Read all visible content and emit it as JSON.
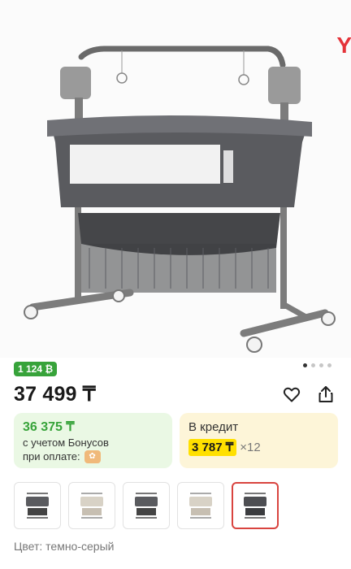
{
  "hero": {
    "brand_fragment": "Y",
    "image_alt": "crib product photo",
    "dots_count": 4,
    "active_dot": 0
  },
  "badge": {
    "bonus_count": "1 124 ₿"
  },
  "price": {
    "main": "37 499 ₸"
  },
  "actions": {
    "favorite_icon": "heart-icon",
    "share_icon": "share-icon"
  },
  "bonus_card": {
    "price": "36 375 ₸",
    "line1": "с учетом Бонусов",
    "line2": "при оплате:"
  },
  "credit_card": {
    "title": "В кредит",
    "amount": "3 787 ₸",
    "multiplier": "×12"
  },
  "thumbnails": {
    "count": 5,
    "selected_index": 4,
    "variants": [
      "dark",
      "light",
      "dark",
      "light",
      "dark"
    ]
  },
  "color": {
    "label": "Цвет: темно-серый"
  },
  "colors": {
    "accent_green": "#37a33a",
    "credit_yellow": "#ffe000",
    "selected_border": "#d9443f"
  }
}
